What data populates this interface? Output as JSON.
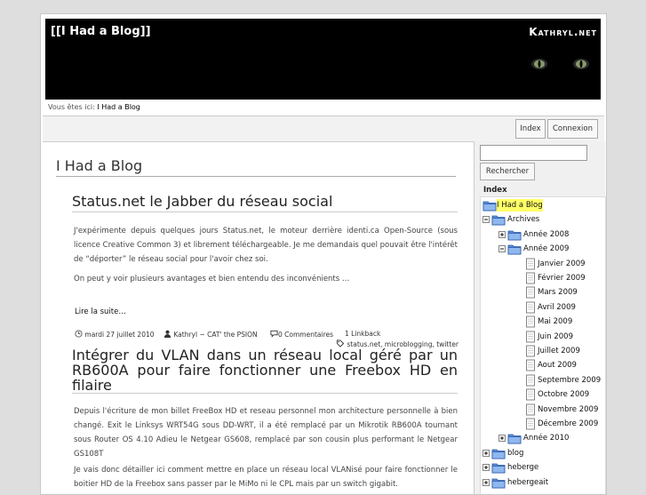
{
  "header": {
    "site_title": "[[I Had a Blog]]",
    "site_domain": "Kathryl.net"
  },
  "breadcrumb": {
    "prefix": "Vous êtes ici:",
    "current": "I Had a Blog"
  },
  "toolbar": {
    "index_label": "Index",
    "login_label": "Connexion"
  },
  "main": {
    "title": "I Had a Blog",
    "posts": [
      {
        "title": "Status.net le Jabber du réseau social",
        "paragraphs": [
          "J'expérimente depuis quelques jours Status.net, le moteur derrière identi.ca Open-Source (sous licence Creative Common 3) et librement téléchargeable. Je me demandais quel pouvait être l'intérêt de “déporter” le réseau social pour l'avoir chez soi.",
          "On peut y voir plusieurs avantages et bien entendu des inconvénients …"
        ],
        "read_more": "Lire la suite…",
        "date": "mardi 27 juillet 2010",
        "author": "Kathryl ~ CAT' the PSION",
        "comments": "0 Commentaires",
        "linkback": "1 Linkback",
        "tags": "status.net, microblogging, twitter"
      },
      {
        "title": "Intégrer du VLAN dans un réseau local géré par un RB600A pour faire fonctionner une Freebox HD en filaire",
        "paragraphs": [
          "Depuis l'écriture de mon billet FreeBox HD et reseau personnel mon architecture personnelle à bien changé. Exit le Linksys WRT54G sous DD-WRT, il a été remplacé par un Mikrotik RB600A tournant sous Router OS 4.10 Adieu le Netgear GS608, remplacé par son cousin plus performant le Netgear GS108T",
          "Je vais donc détailler ici comment mettre en place un réseau local VLANisé pour faire fonctionner le boitier HD de la Freebox sans passer par le MiMo ni le CPL mais par un switch gigabit."
        ]
      }
    ]
  },
  "sidebar": {
    "search_placeholder": "",
    "search_button": "Rechercher",
    "index_label": "Index",
    "tree": [
      {
        "label": "I Had a Blog"
      },
      {
        "label": "Archives"
      },
      {
        "label": "Année 2008"
      },
      {
        "label": "Année 2009"
      },
      {
        "label": "Janvier 2009"
      },
      {
        "label": "Février 2009"
      },
      {
        "label": "Mars 2009"
      },
      {
        "label": "Avril 2009"
      },
      {
        "label": "Mai 2009"
      },
      {
        "label": "Juin 2009"
      },
      {
        "label": "Juillet 2009"
      },
      {
        "label": "Aout 2009"
      },
      {
        "label": "Septembre 2009"
      },
      {
        "label": "Octobre 2009"
      },
      {
        "label": "Novembre 2009"
      },
      {
        "label": "Décembre 2009"
      },
      {
        "label": "Année 2010"
      },
      {
        "label": "blog"
      },
      {
        "label": "heberge"
      },
      {
        "label": "hebergeait"
      }
    ]
  },
  "colors": {
    "header_bg": "#000000",
    "highlight": "#ffff66",
    "folder": "#5a8fd8"
  }
}
